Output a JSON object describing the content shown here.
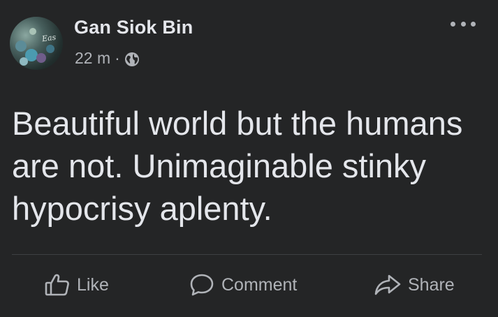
{
  "post": {
    "author": "Gan Siok Bin",
    "time": "22 m",
    "separator": "·",
    "privacy_icon": "globe-icon",
    "avatar_logo_text": "Eas",
    "text": "Beautiful world but the humans are not. Unimaginable stinky hypocrisy aplenty.",
    "more_icon": "more-options-icon"
  },
  "actions": {
    "like": {
      "label": "Like",
      "icon": "thumbs-up-icon"
    },
    "comment": {
      "label": "Comment",
      "icon": "comment-bubble-icon"
    },
    "share": {
      "label": "Share",
      "icon": "share-arrow-icon"
    }
  },
  "colors": {
    "background": "#242526",
    "primary_text": "#e4e6eb",
    "secondary_text": "#b0b3b8",
    "divider": "#3e4042"
  }
}
